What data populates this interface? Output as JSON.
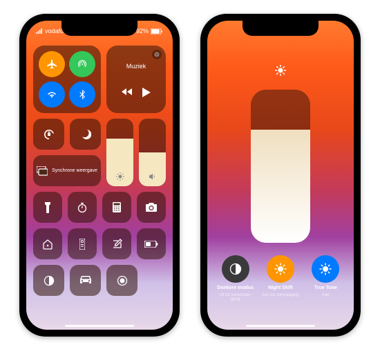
{
  "status": {
    "carrier": "vodafone NL",
    "battery_pct": "92%"
  },
  "music": {
    "title": "Muziek"
  },
  "screen_mirror": {
    "label": "Synchrone weergave"
  },
  "sliders": {
    "brightness_pct": 70,
    "volume_pct": 50
  },
  "brightness_detail": {
    "level_pct": 74,
    "options": [
      {
        "title": "Donkere modus",
        "sub": "Uit tot zonsonder-gang",
        "color": "#3a3a3a"
      },
      {
        "title": "Night Shift",
        "sub": "Aan tot zonsopgang",
        "color": "#ff9500"
      },
      {
        "title": "True Tone",
        "sub": "Aan",
        "color": "#007aff"
      }
    ]
  }
}
